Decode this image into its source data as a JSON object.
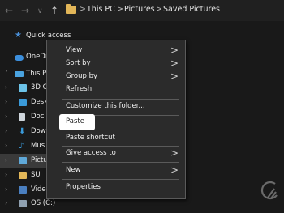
{
  "address_bar": {
    "crumbs": [
      "This PC",
      "Pictures",
      "Saved Pictures"
    ],
    "separator": ">",
    "back_glyph": "←",
    "forward_glyph": "→",
    "recent_glyph": "∨",
    "up_glyph": "↑"
  },
  "nav_pane": {
    "items": [
      {
        "label": "Quick access",
        "icon": "star-icon"
      },
      {
        "label": "OneDri",
        "icon": "cloud-icon"
      },
      {
        "label": "This P",
        "icon": "computer-icon"
      },
      {
        "label": "3D C",
        "icon": "cube-icon"
      },
      {
        "label": "Desk",
        "icon": "desktop-icon"
      },
      {
        "label": "Doc",
        "icon": "document-icon"
      },
      {
        "label": "Dow",
        "icon": "download-icon"
      },
      {
        "label": "Mus",
        "icon": "music-icon"
      },
      {
        "label": "Pictu",
        "icon": "pictures-icon"
      },
      {
        "label": "SU",
        "icon": "folder-icon"
      },
      {
        "label": "Vide",
        "icon": "video-icon"
      },
      {
        "label": "OS (C:)",
        "icon": "drive-icon"
      }
    ]
  },
  "context_menu": {
    "view": "View",
    "sort_by": "Sort by",
    "group_by": "Group by",
    "refresh": "Refresh",
    "customize": "Customize this folder...",
    "paste": "Paste",
    "paste_shortcut": "Paste shortcut",
    "give_access": "Give access to",
    "new": "New",
    "properties": "Properties",
    "submenu_arrow": ">"
  },
  "colors": {
    "background": "#191919",
    "menu_background": "#2b2b2b",
    "highlight": "#ffffff",
    "folder": "#e2b658"
  }
}
